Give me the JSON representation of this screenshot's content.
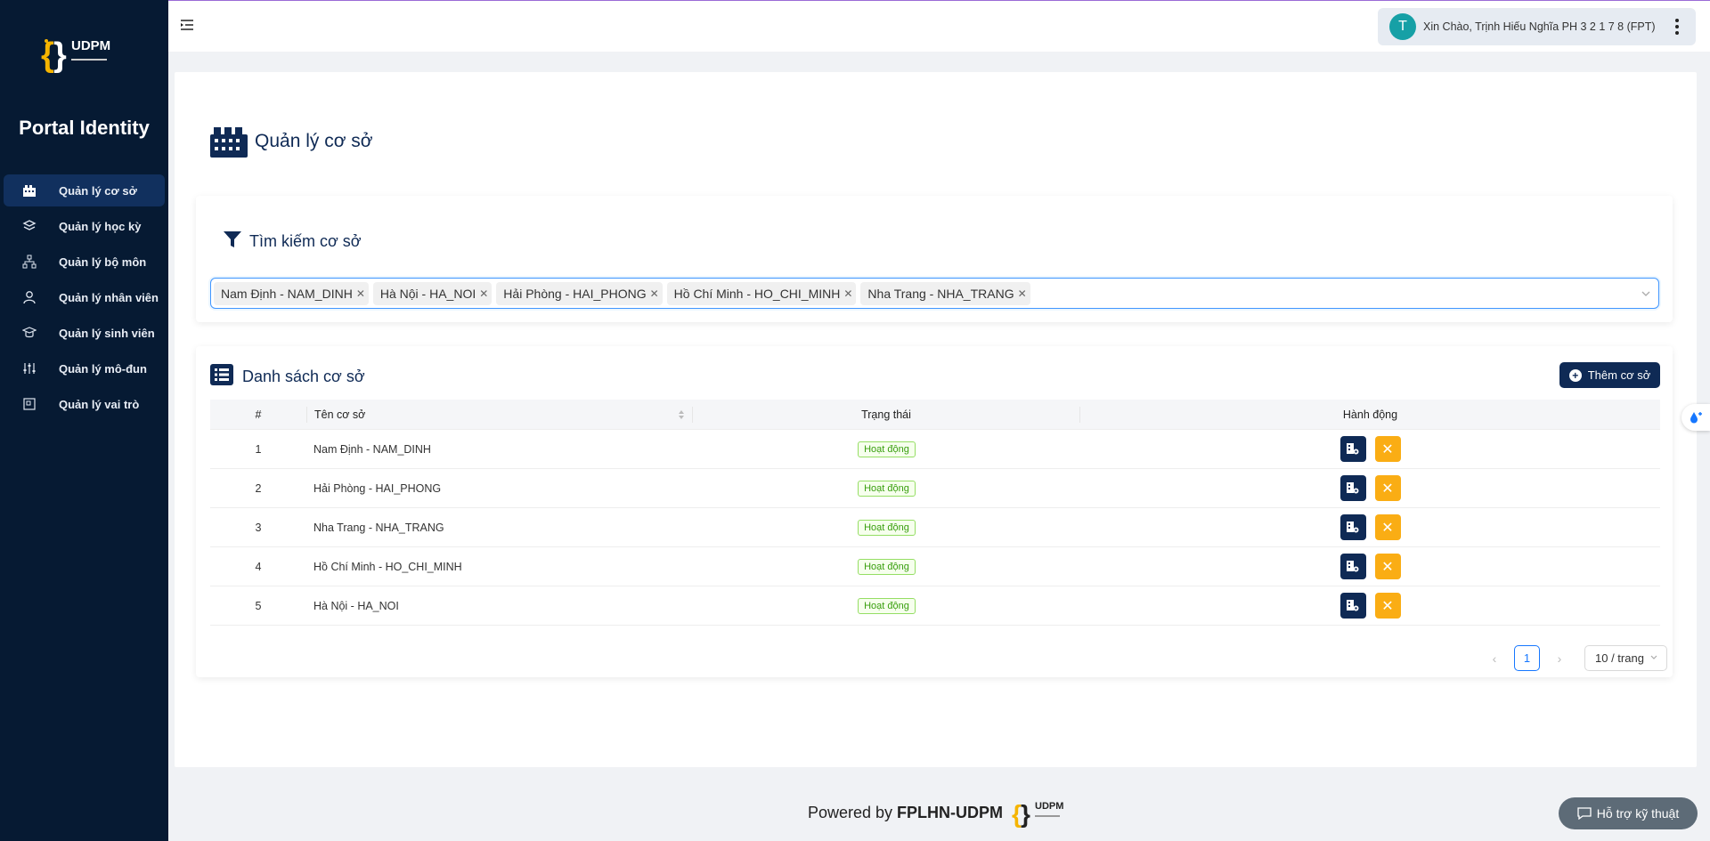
{
  "app": {
    "logo_text": "UDPM",
    "title": "Portal Identity"
  },
  "sidebar": {
    "items": [
      {
        "label": "Quản lý cơ sở",
        "icon": "building-icon",
        "active": true
      },
      {
        "label": "Quản lý học kỳ",
        "icon": "semester-icon"
      },
      {
        "label": "Quản lý bộ môn",
        "icon": "department-icon"
      },
      {
        "label": "Quản lý nhân viên",
        "icon": "user-icon"
      },
      {
        "label": "Quản lý sinh viên",
        "icon": "student-icon"
      },
      {
        "label": "Quản lý mô-đun",
        "icon": "module-icon"
      },
      {
        "label": "Quản lý vai trò",
        "icon": "role-icon"
      }
    ]
  },
  "header": {
    "avatar_letter": "T",
    "greeting": "Xin Chào, Trịnh Hiếu Nghĩa PH 3 2 1 7 8 (FPT)"
  },
  "page": {
    "title": "Quản lý cơ sở"
  },
  "search": {
    "title": "Tìm kiếm cơ sở",
    "tags": [
      "Nam Định - NAM_DINH",
      "Hà Nội - HA_NOI",
      "Hải Phòng - HAI_PHONG",
      "Hồ Chí Minh - HO_CHI_MINH",
      "Nha Trang - NHA_TRANG"
    ]
  },
  "list": {
    "title": "Danh sách cơ sở",
    "add_label": "Thêm cơ sở",
    "columns": [
      "#",
      "Tên cơ sở",
      "Trạng thái",
      "Hành động"
    ],
    "rows": [
      {
        "no": "1",
        "name": "Nam Định - NAM_DINH",
        "status": "Hoạt động"
      },
      {
        "no": "2",
        "name": "Hải Phòng - HAI_PHONG",
        "status": "Hoạt động"
      },
      {
        "no": "3",
        "name": "Nha Trang - NHA_TRANG",
        "status": "Hoạt động"
      },
      {
        "no": "4",
        "name": "Hồ Chí Minh - HO_CHI_MINH",
        "status": "Hoạt động"
      },
      {
        "no": "5",
        "name": "Hà Nội - HA_NOI",
        "status": "Hoạt động"
      }
    ]
  },
  "pagination": {
    "current": "1",
    "page_size": "10 / trang"
  },
  "footer": {
    "powered": "Powered by",
    "brand": "FPLHN-UDPM",
    "logo_text": "UDPM"
  },
  "support": {
    "label": "Hỗ trợ kỹ thuật"
  },
  "colors": {
    "sidebar": "#061a33",
    "primary": "#0f2a55",
    "warning": "#faad14",
    "success": "#389e0d"
  }
}
